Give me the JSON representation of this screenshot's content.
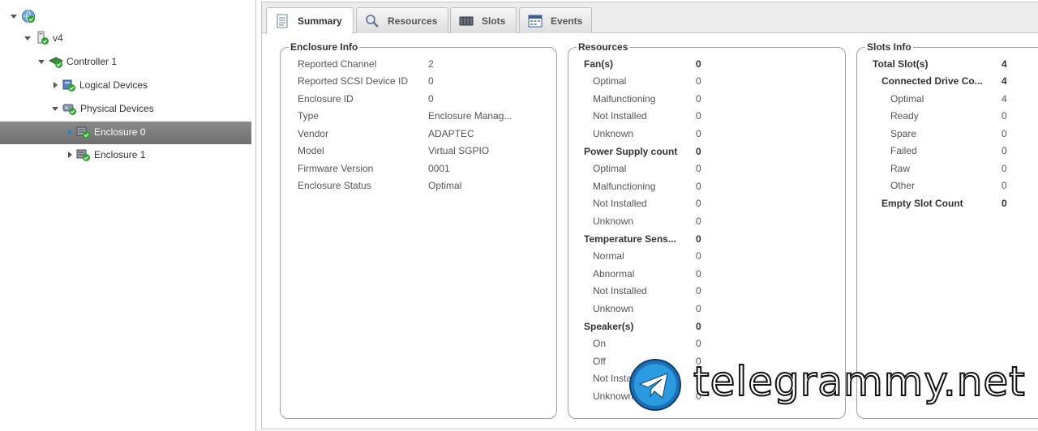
{
  "tree": {
    "nodes": [
      {
        "label": "Enterprise View",
        "icon": "enterprise-globe-icon",
        "toggle": "open"
      },
      {
        "label": "v4",
        "icon": "system-ok-icon",
        "toggle": "open"
      },
      {
        "label": "Controller 1",
        "icon": "controller-ok-icon",
        "toggle": "open"
      },
      {
        "label": "Logical Devices",
        "icon": "logical-devices-icon",
        "toggle": "closed"
      },
      {
        "label": "Physical Devices",
        "icon": "physical-devices-icon",
        "toggle": "open"
      },
      {
        "label": "Enclosure 0",
        "icon": "enclosure-ok-icon",
        "toggle": "closed",
        "selected": true
      },
      {
        "label": "Enclosure 1",
        "icon": "enclosure-ok-icon",
        "toggle": "closed"
      }
    ]
  },
  "tabs": [
    {
      "label": "Summary",
      "icon": "document-icon",
      "active": true
    },
    {
      "label": "Resources",
      "icon": "magnifier-icon"
    },
    {
      "label": "Slots",
      "icon": "slots-icon"
    },
    {
      "label": "Events",
      "icon": "calendar-icon"
    }
  ],
  "enclosure_info": {
    "title": "Enclosure Info",
    "rows": [
      {
        "label": "Reported Channel",
        "value": "2"
      },
      {
        "label": "Reported SCSI Device ID",
        "value": "0"
      },
      {
        "label": "Enclosure ID",
        "value": "0"
      },
      {
        "label": "Type",
        "value": "Enclosure Manag..."
      },
      {
        "label": "Vendor",
        "value": "ADAPTEC"
      },
      {
        "label": "Model",
        "value": "Virtual SGPIO"
      },
      {
        "label": "Firmware Version",
        "value": "0001"
      },
      {
        "label": "Enclosure Status",
        "value": "Optimal"
      }
    ]
  },
  "resources": {
    "title": "Resources",
    "rows": [
      {
        "label": "Fan(s)",
        "value": "0",
        "header": true
      },
      {
        "label": "Optimal",
        "value": "0"
      },
      {
        "label": "Malfunctioning",
        "value": "0"
      },
      {
        "label": "Not Installed",
        "value": "0"
      },
      {
        "label": "Unknown",
        "value": "0"
      },
      {
        "label": "Power Supply count",
        "value": "0",
        "header": true
      },
      {
        "label": "Optimal",
        "value": "0"
      },
      {
        "label": "Malfunctioning",
        "value": "0"
      },
      {
        "label": "Not Installed",
        "value": "0"
      },
      {
        "label": "Unknown",
        "value": "0"
      },
      {
        "label": "Temperature Sens...",
        "value": "0",
        "header": true
      },
      {
        "label": "Normal",
        "value": "0"
      },
      {
        "label": "Abnormal",
        "value": "0"
      },
      {
        "label": "Not Installed",
        "value": "0"
      },
      {
        "label": "Unknown",
        "value": "0"
      },
      {
        "label": "Speaker(s)",
        "value": "0",
        "header": true
      },
      {
        "label": "On",
        "value": "0"
      },
      {
        "label": "Off",
        "value": "0"
      },
      {
        "label": "Not Insta",
        "value": "0"
      },
      {
        "label": "Unknown",
        "value": "0"
      }
    ]
  },
  "slots_info": {
    "title": "Slots Info",
    "rows": [
      {
        "label": "Total Slot(s)",
        "value": "4",
        "level": 0
      },
      {
        "label": "Connected Drive Co...",
        "value": "4",
        "level": 1
      },
      {
        "label": "Optimal",
        "value": "4",
        "level": 2
      },
      {
        "label": "Ready",
        "value": "0",
        "level": 2
      },
      {
        "label": "Spare",
        "value": "0",
        "level": 2
      },
      {
        "label": "Failed",
        "value": "0",
        "level": 2
      },
      {
        "label": "Raw",
        "value": "0",
        "level": 2
      },
      {
        "label": "Other",
        "value": "0",
        "level": 2
      },
      {
        "label": "Empty Slot Count",
        "value": "0",
        "level": 1
      }
    ]
  },
  "watermark": {
    "text": "telegrammy.net",
    "icon": "telegram-logo-icon"
  },
  "colors": {
    "selection": "#7a7a7a",
    "status_ok": "#2aa52a",
    "accent": "#2a7fd4"
  }
}
